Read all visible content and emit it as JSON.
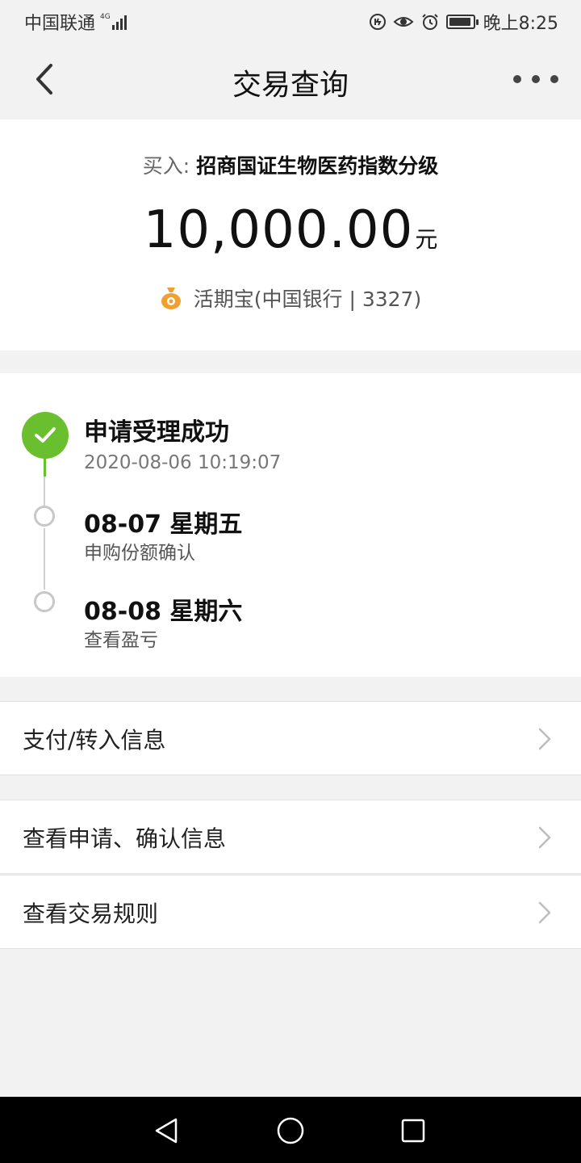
{
  "status_bar": {
    "carrier": "中国联通",
    "network": "4G",
    "time": "晚上8:25"
  },
  "nav": {
    "title": "交易查询",
    "back_icon": "chevron-left-icon",
    "more_icon": "more-dots-icon"
  },
  "summary": {
    "buy_prefix": "买入:",
    "fund_name": "招商国证生物医药指数分级",
    "amount": "10,000.00",
    "unit": "元",
    "account": "活期宝(中国银行 | 3327)",
    "account_icon": "money-bag-icon"
  },
  "progress": {
    "steps": [
      {
        "title": "申请受理成功",
        "subtitle": "2020-08-06 10:19:07",
        "status": "done"
      },
      {
        "title": "08-07 星期五",
        "subtitle": "申购份额确认",
        "status": "pending"
      },
      {
        "title": "08-08 星期六",
        "subtitle": "查看盈亏",
        "status": "pending"
      }
    ]
  },
  "rows": [
    {
      "label": "支付/转入信息"
    },
    {
      "label": "查看申请、确认信息"
    },
    {
      "label": "查看交易规则"
    }
  ],
  "colors": {
    "success_green": "#6abf2e",
    "bag_orange": "#f0a030"
  }
}
